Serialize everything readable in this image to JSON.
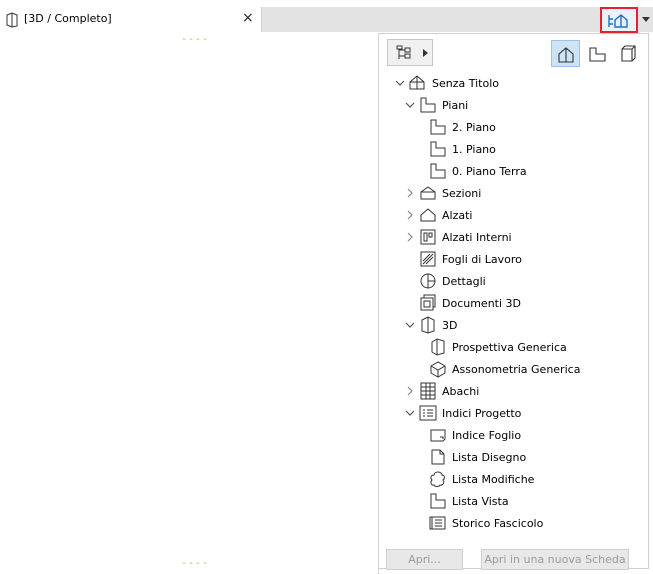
{
  "tab": {
    "title": "[3D / Completo]",
    "close": "×"
  },
  "dashes": {
    "top": "----",
    "bottom": "----"
  },
  "tree": [
    {
      "label": "Senza Titolo",
      "icon": "project-icon",
      "chevron": "down",
      "level": 0
    },
    {
      "label": "Piani",
      "icon": "story-icon",
      "chevron": "down",
      "level": 1
    },
    {
      "label": "2. Piano",
      "icon": "story-icon",
      "chevron": "",
      "level": 2
    },
    {
      "label": "1. Piano",
      "icon": "story-icon",
      "chevron": "",
      "level": 2
    },
    {
      "label": "0. Piano Terra",
      "icon": "story-icon",
      "chevron": "",
      "level": 2
    },
    {
      "label": "Sezioni",
      "icon": "section-icon",
      "chevron": "right",
      "level": 1
    },
    {
      "label": "Alzati",
      "icon": "elevation-icon",
      "chevron": "right",
      "level": 1
    },
    {
      "label": "Alzati Interni",
      "icon": "interior-elevation-icon",
      "chevron": "right",
      "level": 1
    },
    {
      "label": "Fogli di Lavoro",
      "icon": "worksheet-icon",
      "chevron": "",
      "level": 1
    },
    {
      "label": "Dettagli",
      "icon": "detail-icon",
      "chevron": "",
      "level": 1
    },
    {
      "label": "Documenti 3D",
      "icon": "3d-document-icon",
      "chevron": "",
      "level": 1
    },
    {
      "label": "3D",
      "icon": "3d-icon",
      "chevron": "down",
      "level": 1
    },
    {
      "label": "Prospettiva Generica",
      "icon": "perspective-icon",
      "chevron": "",
      "level": 2
    },
    {
      "label": "Assonometria Generica",
      "icon": "axonometry-icon",
      "chevron": "",
      "level": 2
    },
    {
      "label": "Abachi",
      "icon": "schedule-icon",
      "chevron": "right",
      "level": 1
    },
    {
      "label": "Indici Progetto",
      "icon": "project-index-icon",
      "chevron": "down",
      "level": 1
    },
    {
      "label": "Indice Foglio",
      "icon": "sheet-index-icon",
      "chevron": "",
      "level": 2
    },
    {
      "label": "Lista Disegno",
      "icon": "drawing-list-icon",
      "chevron": "",
      "level": 2
    },
    {
      "label": "Lista Modifiche",
      "icon": "change-list-icon",
      "chevron": "",
      "level": 2
    },
    {
      "label": "Lista Vista",
      "icon": "view-list-icon",
      "chevron": "",
      "level": 2
    },
    {
      "label": "Storico Fascicolo",
      "icon": "issue-history-icon",
      "chevron": "",
      "level": 2
    }
  ],
  "buttons": {
    "open": "Apri...",
    "open_new_tab": "Apri in una nuova Scheda"
  },
  "colors": {
    "highlight": "#e8202a",
    "active": "#cde4f7",
    "dash": "#e8a33a",
    "icon_blue": "#1f6fc5"
  }
}
